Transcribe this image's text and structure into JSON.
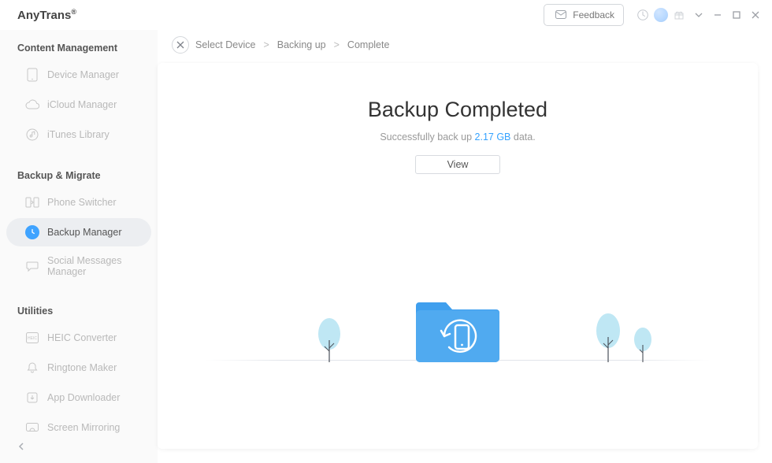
{
  "app": {
    "name": "AnyTrans",
    "reg": "®"
  },
  "header": {
    "feedback": "Feedback"
  },
  "sidebar": {
    "sections": [
      {
        "heading": "Content Management",
        "items": [
          {
            "label": "Device Manager",
            "icon": "device-icon"
          },
          {
            "label": "iCloud Manager",
            "icon": "cloud-icon"
          },
          {
            "label": "iTunes Library",
            "icon": "itunes-icon"
          }
        ]
      },
      {
        "heading": "Backup & Migrate",
        "items": [
          {
            "label": "Phone Switcher",
            "icon": "switch-icon"
          },
          {
            "label": "Backup Manager",
            "icon": "clock-icon",
            "active": true
          },
          {
            "label": "Social Messages Manager",
            "icon": "chat-icon"
          }
        ]
      },
      {
        "heading": "Utilities",
        "items": [
          {
            "label": "HEIC Converter",
            "icon": "heic-icon"
          },
          {
            "label": "Ringtone Maker",
            "icon": "bell-icon"
          },
          {
            "label": "App Downloader",
            "icon": "download-icon"
          },
          {
            "label": "Screen Mirroring",
            "icon": "mirror-icon"
          }
        ]
      }
    ]
  },
  "breadcrumb": {
    "items": [
      "Select Device",
      "Backing up",
      "Complete"
    ]
  },
  "result": {
    "title": "Backup Completed",
    "prefix": "Successfully back up ",
    "size": "2.17 GB",
    "suffix": "  data.",
    "view": "View"
  },
  "colors": {
    "accent": "#36a3ff",
    "folder": "#4ea8ee",
    "tree": "#bfe7f4"
  }
}
